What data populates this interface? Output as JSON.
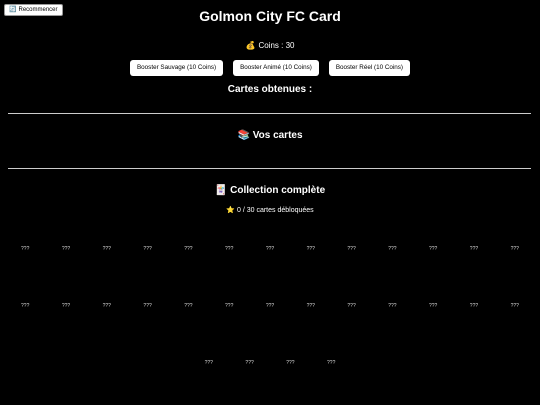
{
  "header": {
    "restart_label": "Recommencer",
    "restart_icon": "refresh-icon",
    "title": "Golmon City FC Card"
  },
  "coins": {
    "icon": "money-bag-icon",
    "label": "Coins : 30"
  },
  "boosters": [
    {
      "label": "Booster Sauvage (10 Coins)"
    },
    {
      "label": "Booster Animé (10 Coins)"
    },
    {
      "label": "Booster Réel (10 Coins)"
    }
  ],
  "obtained_title": "Cartes obtenues :",
  "my_cards": {
    "icon": "books-icon",
    "title": "Vos cartes"
  },
  "collection": {
    "icon": "card-icon",
    "title": "Collection complète",
    "progress_icon": "star-icon",
    "progress_label": "0 / 30 cartes débloquées",
    "unlocked": 0,
    "total": 30,
    "cards": [
      "???",
      "???",
      "???",
      "???",
      "???",
      "???",
      "???",
      "???",
      "???",
      "???",
      "???",
      "???",
      "???",
      "???",
      "???",
      "???",
      "???",
      "???",
      "???",
      "???",
      "???",
      "???",
      "???",
      "???",
      "???",
      "???",
      "???",
      "???",
      "???",
      "???"
    ]
  }
}
